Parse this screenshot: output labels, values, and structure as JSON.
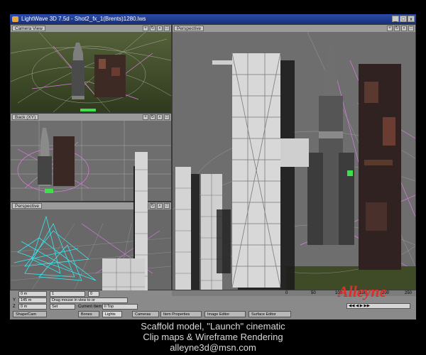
{
  "window": {
    "title": "LightWave 3D 7.5d - Shot2_fx_1(Brents)1280.lws",
    "min_label": "_",
    "max_label": "□",
    "close_label": "x"
  },
  "viewports": {
    "camera": {
      "label": "Camera View"
    },
    "back": {
      "label": "Back",
      "extra": "(XY)"
    },
    "perspective_small": {
      "label": "Perspective"
    },
    "perspective_main": {
      "label": "Perspective"
    }
  },
  "timeline": {
    "ticks": [
      "0",
      "50",
      "100",
      "150",
      "200",
      "250"
    ]
  },
  "toolbar": {
    "row1_value1": "0 m",
    "row1_value2": "1",
    "row1_value3": "0",
    "row2_label": "Y",
    "row2_value": "145 m",
    "row2_status": "Drag mouse in view to or",
    "row3_label": "Z",
    "row3_value": "0 m",
    "row3_set": "Set",
    "current_item_label": "Current Item",
    "current_item_value": "Il Top",
    "tabs": [
      "Shape/Cam",
      "Bones",
      "Lights",
      "Cameras",
      "Item Properties"
    ],
    "bottom_tabs": [
      "Image Editor",
      "Surface Editor"
    ]
  },
  "watermark": "Alleyne",
  "caption": {
    "line1": "Scaffold model, \"Launch\" cinematic",
    "line2": "Clip maps & Wireframe Rendering",
    "line3": "alleyne3d@msn.com"
  },
  "colors": {
    "title_bar": "#1d3a8f",
    "viewport_bg": "#6e6e6e",
    "wire_magenta": "#e07ae6",
    "wire_cyan": "#38e6f0",
    "grass": "#3b4a22",
    "watermark": "#d8322b"
  }
}
